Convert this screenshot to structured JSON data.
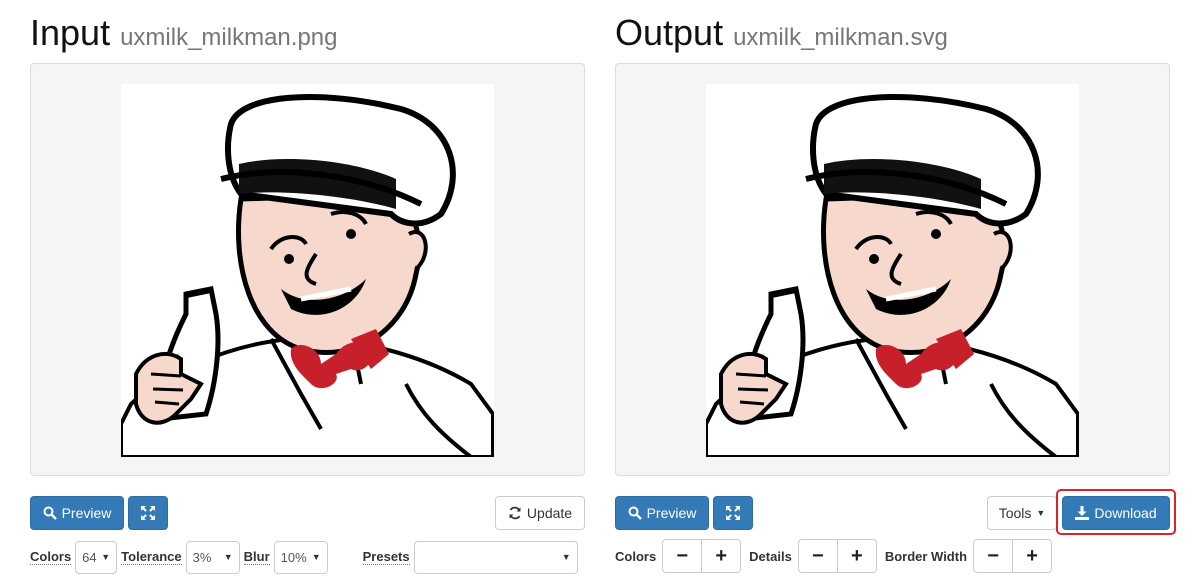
{
  "input": {
    "title": "Input",
    "filename": "uxmilk_milkman.png",
    "preview_label": "Preview",
    "update_label": "Update",
    "controls": {
      "colors_label": "Colors",
      "colors_value": "64",
      "tolerance_label": "Tolerance",
      "tolerance_value": "3%",
      "blur_label": "Blur",
      "blur_value": "10%",
      "presets_label": "Presets",
      "presets_value": ""
    }
  },
  "output": {
    "title": "Output",
    "filename": "uxmilk_milkman.svg",
    "preview_label": "Preview",
    "tools_label": "Tools",
    "download_label": "Download",
    "controls": {
      "colors_label": "Colors",
      "details_label": "Details",
      "border_width_label": "Border Width",
      "minus": "−",
      "plus": "+"
    }
  },
  "colors": {
    "primary": "#337ab7",
    "highlight": "#e0202a",
    "skin": "#f7d8cc",
    "bowtie": "#c8202a"
  }
}
